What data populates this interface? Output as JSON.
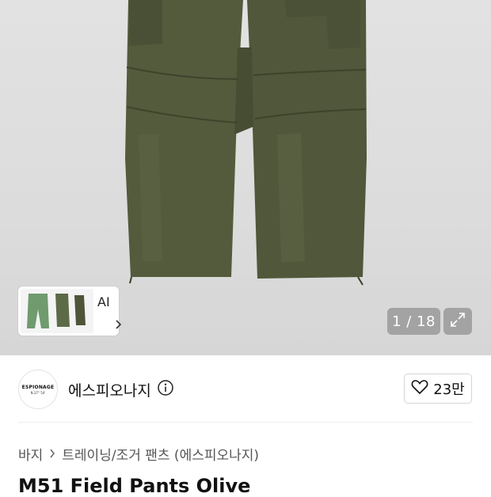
{
  "gallery": {
    "ai_label": "AI",
    "counter": "1 / 18",
    "icons": {
      "ai_chevron": "chevron-right-icon",
      "expand": "expand-icon"
    }
  },
  "brand": {
    "logo_line1": "ESPIONAGE",
    "logo_line2": "N.37° 54'",
    "name": "에스피오나지",
    "info_icon": "info-icon"
  },
  "like": {
    "count": "23만",
    "icon": "heart-icon"
  },
  "breadcrumb": {
    "category": "바지",
    "subcategory": "트레이닝/조거 팬츠 (에스피오나지)"
  },
  "product": {
    "title": "M51 Field Pants Olive"
  }
}
